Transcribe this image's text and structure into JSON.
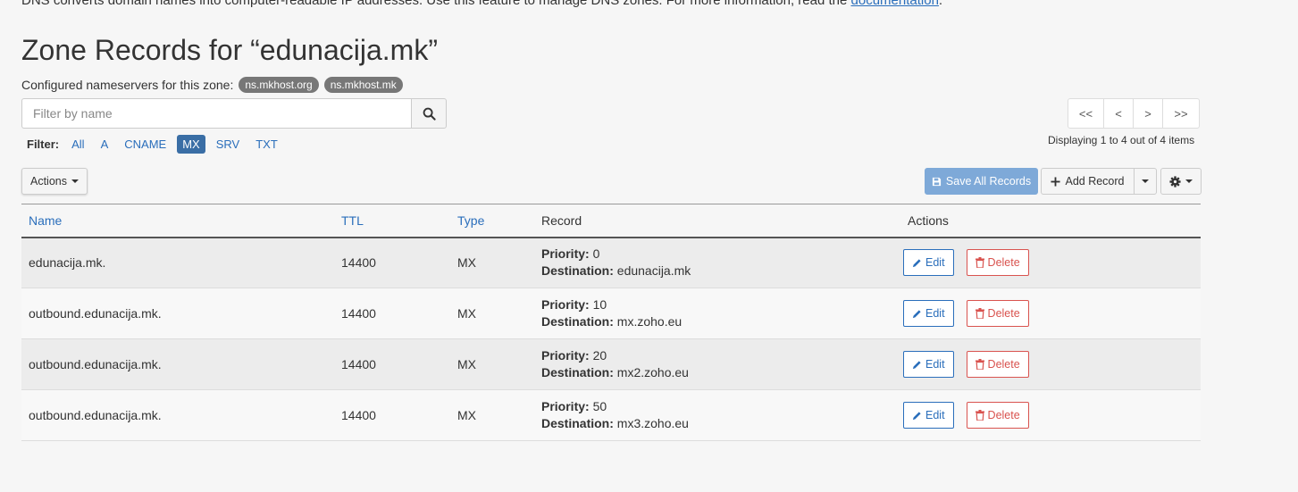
{
  "intro": {
    "text": "DNS converts domain names into computer-readable IP addresses. Use this feature to manage DNS zones. For more information, read the ",
    "link": "documentation",
    "suffix": "."
  },
  "title": "Zone Records for “edunacija.mk”",
  "nameservers": {
    "label": "Configured nameservers for this zone:",
    "items": [
      "ns.mkhost.org",
      "ns.mkhost.mk"
    ]
  },
  "search": {
    "placeholder": "Filter by name",
    "value": ""
  },
  "filter": {
    "label": "Filter:",
    "options": [
      "All",
      "A",
      "CNAME",
      "MX",
      "SRV",
      "TXT"
    ],
    "active": "MX"
  },
  "pager": {
    "buttons": [
      "<<",
      "<",
      ">",
      ">>"
    ],
    "status": "Displaying 1 to 4 out of 4 items"
  },
  "toolbar": {
    "actions_label": "Actions",
    "save_all_label": "Save All Records",
    "add_record_label": "Add Record"
  },
  "table": {
    "columns": [
      "Name",
      "TTL",
      "Type",
      "Record",
      "Actions"
    ],
    "priority_label": "Priority:",
    "destination_label": "Destination:",
    "edit_label": "Edit",
    "delete_label": "Delete",
    "rows": [
      {
        "name": "edunacija.mk.",
        "ttl": "14400",
        "type": "MX",
        "priority": "0",
        "destination": "edunacija.mk"
      },
      {
        "name": "outbound.edunacija.mk.",
        "ttl": "14400",
        "type": "MX",
        "priority": "10",
        "destination": "mx.zoho.eu"
      },
      {
        "name": "outbound.edunacija.mk.",
        "ttl": "14400",
        "type": "MX",
        "priority": "20",
        "destination": "mx2.zoho.eu"
      },
      {
        "name": "outbound.edunacija.mk.",
        "ttl": "14400",
        "type": "MX",
        "priority": "50",
        "destination": "mx3.zoho.eu"
      }
    ]
  },
  "icons": {
    "search": "search-icon",
    "save": "floppy-disk-icon",
    "add": "plus-icon",
    "gear": "gear-icon",
    "edit": "pencil-icon",
    "delete": "trash-icon"
  },
  "colors": {
    "link": "#2a6ebb",
    "active_filter": "#3a6ea5",
    "save_button": "#7ea9d8",
    "delete": "#d9534f",
    "badge": "#777777"
  }
}
